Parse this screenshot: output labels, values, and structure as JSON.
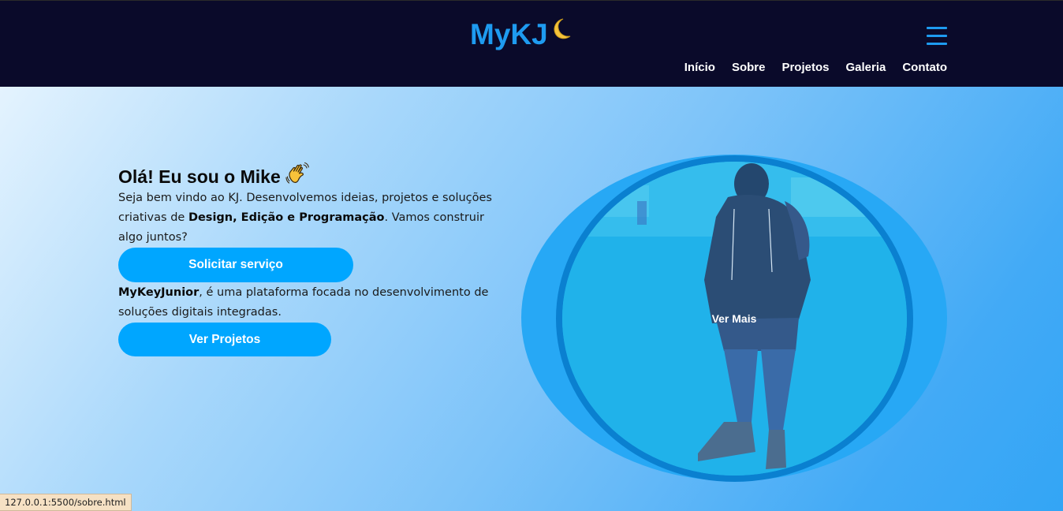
{
  "header": {
    "logo_text": "MyKJ",
    "logo_icon": "crescent-moon-icon",
    "menu_icon": "hamburger-menu-icon",
    "nav_items": [
      "Início",
      "Sobre",
      "Projetos",
      "Galeria",
      "Contato"
    ]
  },
  "hero": {
    "greeting": "Olá! Eu sou o Mike",
    "greeting_icon": "waving-hand-icon",
    "intro_prefix": "Seja bem vindo ao KJ. Desenvolvemos ideias, projetos e soluções criativas de ",
    "intro_bold": "Design, Edição e Programação",
    "intro_suffix": ". Vamos construir algo juntos?",
    "primary_button": "Solicitar serviço",
    "about_bold": "MyKeyJunior",
    "about_text": ", é uma plataforma focada no desenvolvimento de soluções digitais integradas.",
    "secondary_button": "Ver Projetos",
    "photo_overlay_label": "Ver Mais"
  },
  "status_bar": {
    "url": "127.0.0.1:5500/sobre.html"
  },
  "colors": {
    "header_bg": "#0a0a2a",
    "accent": "#00a6ff",
    "logo": "#1e9bf0",
    "ring": "#0a80d0"
  }
}
